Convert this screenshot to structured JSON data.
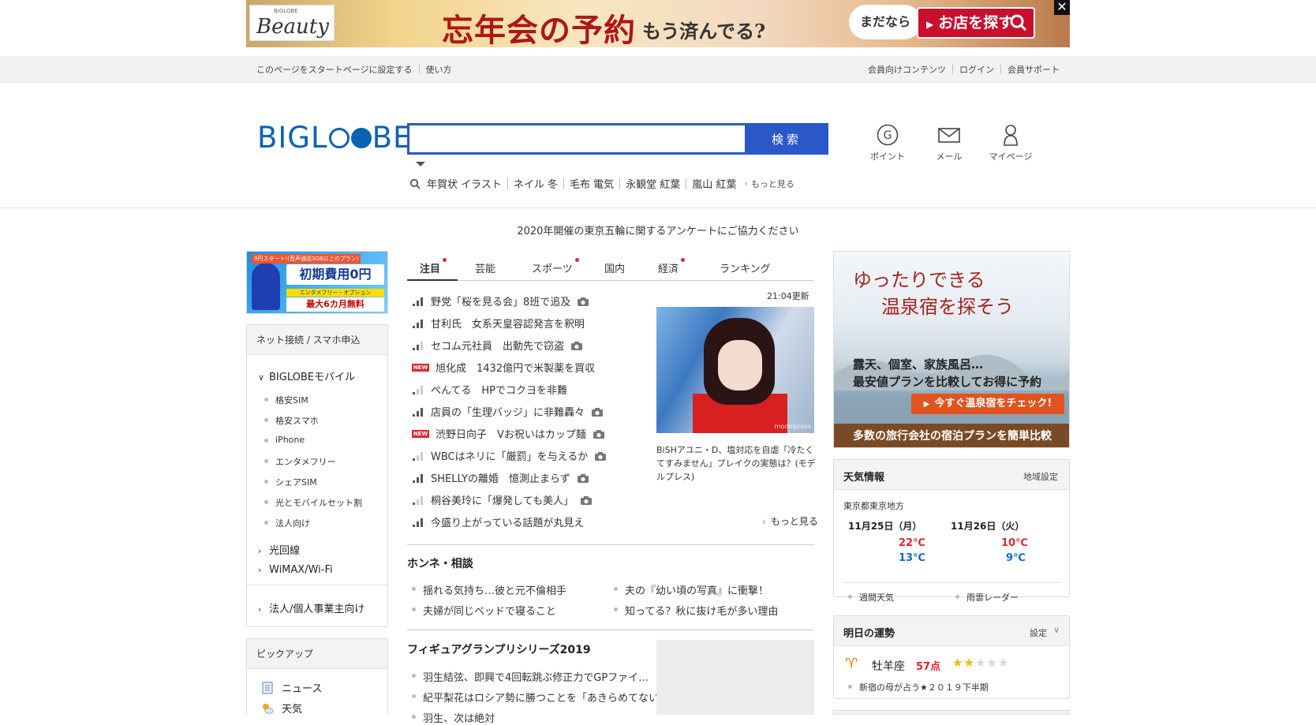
{
  "banner": {
    "brand_small": "BIGLOBE",
    "brand": "Beauty",
    "headline": "忘年会の予約",
    "sub": "もう済んでる?",
    "bubble": "まだなら",
    "cta": "お店を探す",
    "close": "✕"
  },
  "util": {
    "left": [
      "このページをスタートページに設定する",
      "使い方"
    ],
    "right": [
      "会員向けコンテンツ",
      "ログイン",
      "会員サポート"
    ]
  },
  "header": {
    "logo_parts": [
      "BIGL",
      "BE"
    ],
    "search_placeholder": "",
    "search_button": "検索",
    "trends": [
      "年賀状 イラスト",
      "ネイル 冬",
      "毛布 電気",
      "永観堂 紅葉",
      "嵐山 紅葉"
    ],
    "trends_more": "もっと見る",
    "icons": [
      {
        "label": "ポイント",
        "icon": "point-icon"
      },
      {
        "label": "メール",
        "icon": "mail-icon"
      },
      {
        "label": "マイページ",
        "icon": "user-icon"
      }
    ]
  },
  "survey": "2020年開催の東京五輪に関するアンケートにご協力ください",
  "left_ad": {
    "top": "0円スタート!(音声通話3GB以上のプラン)",
    "big": "初期費用0円",
    "band": "エンタメフリー・オプション",
    "bottom": "最大6カ月無料"
  },
  "left_menu": {
    "header": "ネット接続 / スマホ申込",
    "mobile": "BIGLOBEモバイル",
    "mobile_items": [
      "格安SIM",
      "格安スマホ",
      "iPhone",
      "エンタメフリー",
      "シェアSIM",
      "光とモバイルセット割",
      "法人向け"
    ],
    "hikari": "光回線",
    "wimax": "WiMAX/Wi-Fi",
    "business": "法人/個人事業主向け"
  },
  "pickup": {
    "header": "ピックアップ",
    "items": [
      {
        "label": "ニュース",
        "icon": "news-icon"
      },
      {
        "label": "天気",
        "icon": "weather-icon"
      }
    ]
  },
  "tabs": [
    {
      "label": "注目",
      "dot": true,
      "active": true
    },
    {
      "label": "芸能",
      "dot": false
    },
    {
      "label": "スポーツ",
      "dot": true
    },
    {
      "label": "国内",
      "dot": false
    },
    {
      "label": "経済",
      "dot": true
    },
    {
      "label": "ランキング",
      "dot": false
    }
  ],
  "news": {
    "updated": "21:04更新",
    "new_badge": "NEW",
    "items": [
      {
        "title": "野党「桜を見る会」8班で追及",
        "rank": "high",
        "photo": true
      },
      {
        "title": "甘利氏　女系天皇容認発言を釈明",
        "rank": "high",
        "photo": false
      },
      {
        "title": "セコム元社員　出動先で窃盗",
        "rank": "mid",
        "photo": true
      },
      {
        "title": "旭化成　1432億円で米製薬を買収",
        "rank": "new",
        "photo": false
      },
      {
        "title": "ぺんてる　HPでコクヨを非難",
        "rank": "low",
        "photo": false
      },
      {
        "title": "店員の「生理バッジ」に非難轟々",
        "rank": "high",
        "photo": true
      },
      {
        "title": "渋野日向子　Vお祝いはカップ麺",
        "rank": "new",
        "photo": true
      },
      {
        "title": "WBCはネリに「厳罰」を与えるか",
        "rank": "low",
        "photo": true
      },
      {
        "title": "SHELLYの離婚　憶測止まらず",
        "rank": "high",
        "photo": true
      },
      {
        "title": "桐谷美玲に「爆発しても美人」",
        "rank": "low",
        "photo": true
      },
      {
        "title": "今盛り上がっている話題が丸見え",
        "rank": "high",
        "photo": false
      }
    ],
    "photo_caption": "BiSHアユニ・D、塩対応を自虐「冷たくてすみません」ブレイクの実態は？(モデルプレス)",
    "photo_watermark": "modelpress",
    "more": "もっと見る"
  },
  "honne": {
    "title": "ホンネ・相談",
    "items": [
      "揺れる気持ち…彼と元不倫相手",
      "夫の『幼い頃の写真』に衝撃！",
      "夫婦が同じベッドで寝ること",
      "知ってる？秋に抜け毛が多い理由"
    ]
  },
  "figure": {
    "title": "フィギュアグランプリシリーズ2019",
    "items": [
      "羽生結弦、即興で4回転跳ぶ修正力でGPファイ…",
      "紀平梨花はロシア勢に勝つことを「あきらめてない」…",
      "羽生、次は絶対"
    ]
  },
  "right_ad": {
    "title1": "ゆったりできる",
    "title2": "温泉宿を探そう",
    "body1": "露天、個室、家族風呂…",
    "body2": "最安値プランを比較してお得に予約",
    "cta": "今すぐ温泉宿をチェック!",
    "foot": "多数の旅行会社の宿泊プランを簡単比較"
  },
  "weather": {
    "title": "天気情報",
    "setting": "地域設定",
    "region": "東京都東京地方",
    "days": [
      {
        "date": "11月25日（月）",
        "hi": "22℃",
        "lo": "13℃"
      },
      {
        "date": "11月26日（火）",
        "hi": "10℃",
        "lo": "9℃"
      }
    ],
    "links": [
      "週間天気",
      "雨雲レーダー"
    ]
  },
  "fortune": {
    "title": "明日の運勢",
    "setting": "設定",
    "sign": "牡羊座",
    "score": "57点",
    "stars": 2,
    "stars_max": 5,
    "note": "新宿の母が占う★２０１９下半期"
  },
  "colors": {
    "accent": "#2b58c9",
    "logo": "#0a62b5",
    "alert": "#e5242b",
    "cold": "#1566c9"
  }
}
